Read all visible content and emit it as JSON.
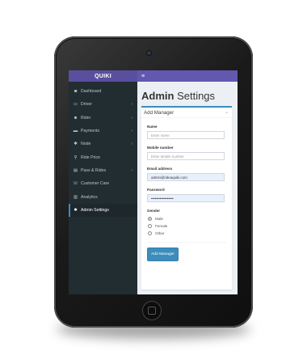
{
  "app": {
    "brand": "QUIKI",
    "menu_icon": "hamburger-icon",
    "menu_glyph": "≡"
  },
  "sidebar": {
    "items": [
      {
        "label": "Dashboard",
        "icon": "dashboard-icon",
        "glyph": "◙",
        "caret": false,
        "active": false
      },
      {
        "label": "Driver",
        "icon": "id-card-icon",
        "glyph": "▭",
        "caret": true,
        "active": false
      },
      {
        "label": "Rider",
        "icon": "users-icon",
        "glyph": "☻",
        "caret": true,
        "active": false
      },
      {
        "label": "Payments",
        "icon": "credit-card-icon",
        "glyph": "▬",
        "caret": true,
        "active": false
      },
      {
        "label": "Node",
        "icon": "gear-icon",
        "glyph": "✱",
        "caret": true,
        "active": false
      },
      {
        "label": "Ride Price",
        "icon": "pin-icon",
        "glyph": "⚲",
        "caret": false,
        "active": false
      },
      {
        "label": "Pass & Rides",
        "icon": "ticket-icon",
        "glyph": "▤",
        "caret": true,
        "active": false
      },
      {
        "label": "Customer Care",
        "icon": "headset-icon",
        "glyph": "☏",
        "caret": false,
        "active": false
      },
      {
        "label": "Analytics",
        "icon": "bar-chart-icon",
        "glyph": "▥",
        "caret": false,
        "active": false
      },
      {
        "label": "Admin Settings",
        "icon": "cogs-icon",
        "glyph": "✹",
        "caret": false,
        "active": true
      }
    ],
    "caret_glyph": "‹"
  },
  "main": {
    "title_bold": "Admin",
    "title_rest": " Settings",
    "box_title": "Add Manager",
    "collapse_glyph": "⌄",
    "form": {
      "name_label": "Name",
      "name_placeholder": "Enter name",
      "mobile_label": "Mobile number",
      "mobile_placeholder": "Enter Mobile number",
      "email_label": "Email address",
      "email_value": "admin@rideaquiki.com",
      "password_label": "Password",
      "password_value": "••••••••••••••••••",
      "gender_label": "Gender",
      "gender_options": [
        "Male",
        "Female",
        "Other"
      ],
      "gender_selected": "Male",
      "submit_label": "Add Manager"
    }
  },
  "colors": {
    "brand": "#5a4f9e",
    "navbar": "#6258b0",
    "sidebar": "#222d32",
    "accent": "#3c8dbc"
  }
}
